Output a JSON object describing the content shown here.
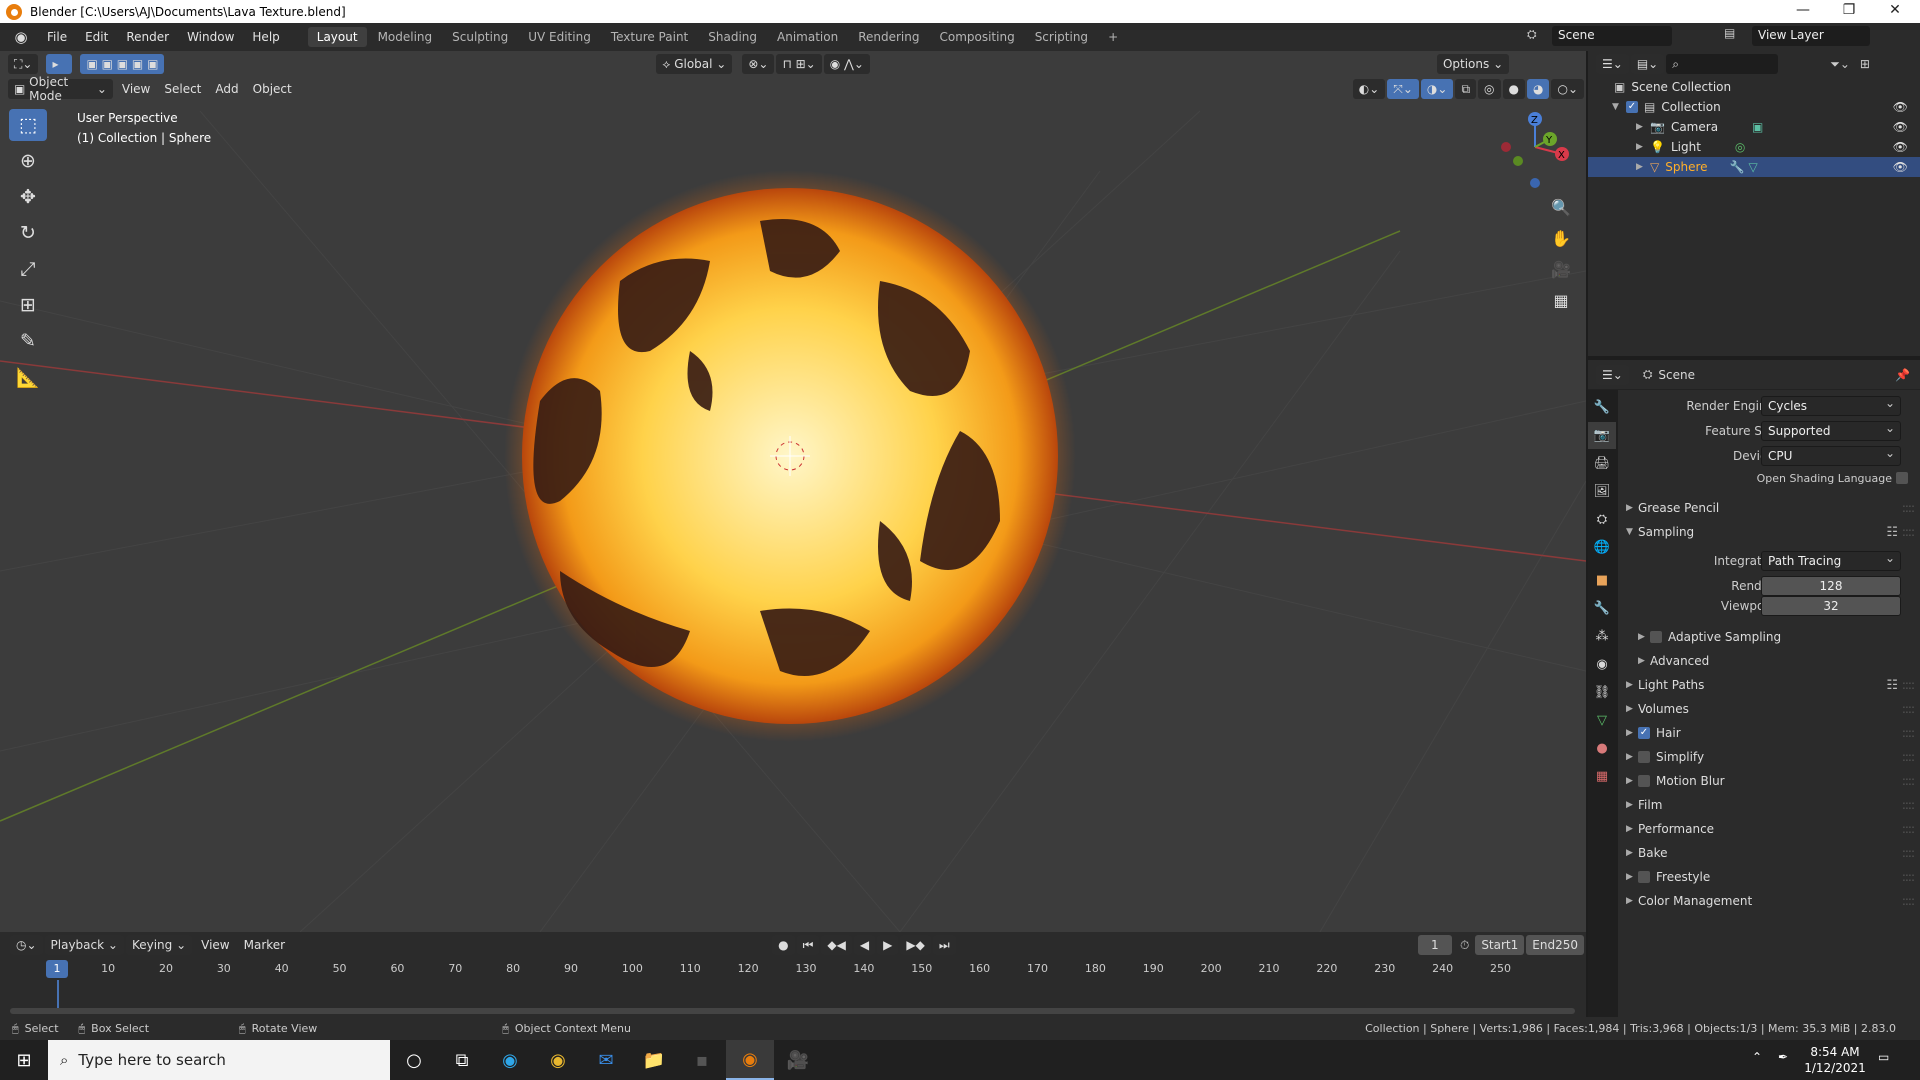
{
  "window": {
    "title": "Blender [C:\\Users\\AJ\\Documents\\Lava Texture.blend]"
  },
  "menu": [
    "File",
    "Edit",
    "Render",
    "Window",
    "Help"
  ],
  "workspaces": [
    "Layout",
    "Modeling",
    "Sculpting",
    "UV Editing",
    "Texture Paint",
    "Shading",
    "Animation",
    "Rendering",
    "Compositing",
    "Scripting"
  ],
  "active_workspace": "Layout",
  "scene_name": "Scene",
  "view_layer": "View Layer",
  "viewport": {
    "orientation": "Global",
    "options": "Options",
    "mode": "Object Mode",
    "menus": [
      "View",
      "Select",
      "Add",
      "Object"
    ],
    "info_line1": "User Perspective",
    "info_line2": "(1) Collection | Sphere"
  },
  "outliner": {
    "root": "Scene Collection",
    "collection": "Collection",
    "items": [
      "Camera",
      "Light",
      "Sphere"
    ],
    "selected": "Sphere"
  },
  "properties": {
    "context": "Scene",
    "render_engine_label": "Render Engine",
    "render_engine": "Cycles",
    "feature_set_label": "Feature Set",
    "feature_set": "Supported",
    "device_label": "Device",
    "device": "CPU",
    "osl_label": "Open Shading Language",
    "grease_pencil": "Grease Pencil",
    "sampling": "Sampling",
    "integrator_label": "Integrator",
    "integrator": "Path Tracing",
    "render_label": "Render",
    "render_samples": "128",
    "viewport_label": "Viewport",
    "viewport_samples": "32",
    "adaptive": "Adaptive Sampling",
    "advanced": "Advanced",
    "light_paths": "Light Paths",
    "volumes": "Volumes",
    "hair": "Hair",
    "simplify": "Simplify",
    "motion_blur": "Motion Blur",
    "film": "Film",
    "performance": "Performance",
    "bake": "Bake",
    "freestyle": "Freestyle",
    "color_management": "Color Management"
  },
  "timeline": {
    "menus": [
      "Playback",
      "Keying",
      "View",
      "Marker"
    ],
    "current_frame": "1",
    "start_label": "Start",
    "start": "1",
    "end_label": "End",
    "end": "250",
    "ticks": [
      "10",
      "20",
      "30",
      "40",
      "50",
      "60",
      "70",
      "80",
      "90",
      "100",
      "110",
      "120",
      "130",
      "140",
      "150",
      "160",
      "170",
      "180",
      "190",
      "200",
      "210",
      "220",
      "230",
      "240",
      "250"
    ]
  },
  "status": {
    "select": "Select",
    "box_select": "Box Select",
    "rotate": "Rotate View",
    "context_menu": "Object Context Menu",
    "stats": "Collection | Sphere | Verts:1,986 | Faces:1,984 | Tris:3,968 | Objects:1/3 | Mem: 35.3 MiB | 2.83.0"
  },
  "taskbar": {
    "search_placeholder": "Type here to search",
    "time": "8:54 AM",
    "date": "1/12/2021"
  },
  "colors": {
    "accent": "#4772b3",
    "blender_orange": "#e87d0d",
    "selection": "#334d80"
  }
}
